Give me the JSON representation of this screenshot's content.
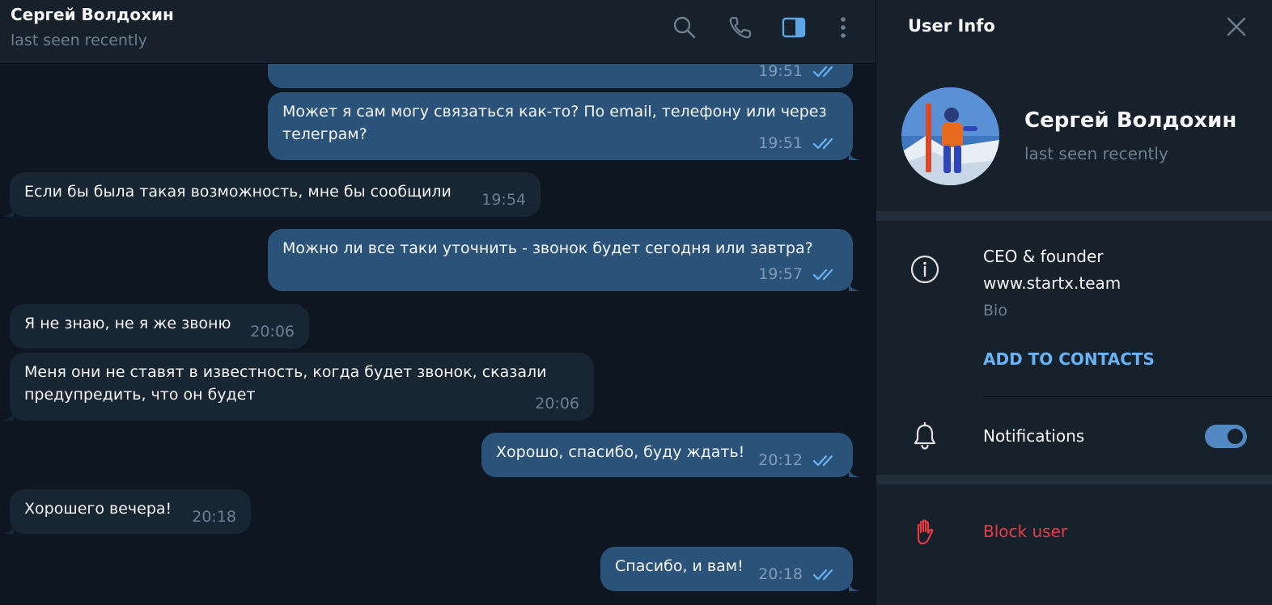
{
  "header": {
    "peer_name": "Сергей Волдохин",
    "peer_status": "last seen recently",
    "icons": [
      "search-icon",
      "phone-icon",
      "sidebar-toggle-icon",
      "more-icon"
    ]
  },
  "messages": [
    {
      "dir": "out",
      "text": "",
      "time": "19:51",
      "read": true
    },
    {
      "dir": "out",
      "text": "Может я сам могу связаться как-то? По email, телефону или через\nтелеграм?",
      "time": "19:51",
      "read": true
    },
    {
      "dir": "in",
      "text": "Если бы была такая возможность, мне бы сообщили",
      "time": "19:54"
    },
    {
      "dir": "out",
      "text": "Можно ли все таки уточнить - звонок будет сегодня или завтра?",
      "time": "19:57",
      "read": true
    },
    {
      "dir": "in",
      "text": "Я не знаю, не я же звоню",
      "time": "20:06"
    },
    {
      "dir": "in",
      "text": "Меня они не ставят в известность, когда будет звонок, сказали\nпредупредить, что он будет",
      "time": "20:06"
    },
    {
      "dir": "out",
      "text": "Хорошо, спасибо, буду ждать!",
      "time": "20:12",
      "read": true
    },
    {
      "dir": "in",
      "text": "Хорошего вечера!",
      "time": "20:18"
    },
    {
      "dir": "out",
      "text": "Спасибо, и вам!",
      "time": "20:18",
      "read": true
    }
  ],
  "info_panel": {
    "title": "User Info",
    "name": "Сергей Волдохин",
    "status": "last seen recently",
    "bio_lines": [
      "CEO & founder",
      "www.startx.team"
    ],
    "bio_label": "Bio",
    "add_contacts": "ADD TO CONTACTS",
    "notifications_label": "Notifications",
    "notifications_on": true,
    "block_label": "Block user"
  },
  "colors": {
    "chat_bg": "#0e1621",
    "panel_bg": "#17212b",
    "outgoing_bubble": "#2b5278",
    "incoming_bubble": "#182533",
    "accent": "#6ab3f3",
    "toggle": "#5288c1",
    "danger": "#ec3942"
  }
}
